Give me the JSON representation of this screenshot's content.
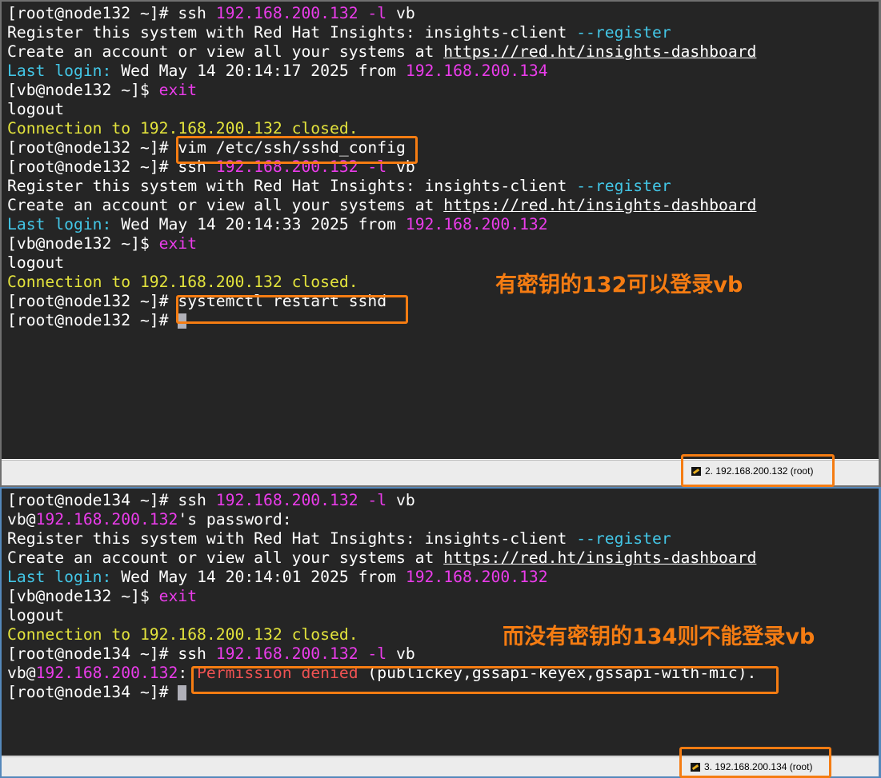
{
  "colors": {
    "terminal_bg": "#252525",
    "text": "#ffffff",
    "ip_magenta": "#ea3cea",
    "option_cyan": "#43c6e6",
    "connection_yellow": "#e3e33c",
    "error_red": "#ee5252",
    "annotation_orange": "#f57c12"
  },
  "panel1": {
    "lines": [
      [
        {
          "t": "[root@node132 ~]# ssh "
        },
        {
          "t": "192.168.200.132",
          "c": "magenta"
        },
        {
          "t": " "
        },
        {
          "t": "-l",
          "c": "magenta"
        },
        {
          "t": " vb"
        }
      ],
      [
        {
          "t": "Register this system with Red Hat Insights: insights-client "
        },
        {
          "t": "--register",
          "c": "cyan"
        }
      ],
      [
        {
          "t": "Create an account or view all your systems at "
        },
        {
          "t": "https://red.ht/insights-dashboard",
          "c": "link"
        }
      ],
      [
        {
          "t": "Last login:",
          "c": "cyan"
        },
        {
          "t": " Wed May 14 20:14:17 2025 from "
        },
        {
          "t": "192.168.200.134",
          "c": "magenta"
        }
      ],
      [
        {
          "t": "[vb@node132 ~]$ "
        },
        {
          "t": "exit",
          "c": "magenta"
        }
      ],
      [
        {
          "t": "logout"
        }
      ],
      [
        {
          "t": "Connection to 192.168.200.132 closed.",
          "c": "yellow"
        }
      ],
      [
        {
          "t": "[root@node132 ~]# vim /etc/ssh/sshd_config"
        }
      ],
      [
        {
          "t": "[root@node132 ~]# ssh "
        },
        {
          "t": "192.168.200.132",
          "c": "magenta"
        },
        {
          "t": " "
        },
        {
          "t": "-l",
          "c": "magenta"
        },
        {
          "t": " vb"
        }
      ],
      [
        {
          "t": "Register this system with Red Hat Insights: insights-client "
        },
        {
          "t": "--register",
          "c": "cyan"
        }
      ],
      [
        {
          "t": "Create an account or view all your systems at "
        },
        {
          "t": "https://red.ht/insights-dashboard",
          "c": "link"
        }
      ],
      [
        {
          "t": "Last login:",
          "c": "cyan"
        },
        {
          "t": " Wed May 14 20:14:33 2025 from "
        },
        {
          "t": "192.168.200.132",
          "c": "magenta"
        }
      ],
      [
        {
          "t": "[vb@node132 ~]$ "
        },
        {
          "t": "exit",
          "c": "magenta"
        }
      ],
      [
        {
          "t": "logout"
        }
      ],
      [
        {
          "t": "Connection to 192.168.200.132 closed.",
          "c": "yellow"
        }
      ],
      [
        {
          "t": "[root@node132 ~]# systemctl restart sshd"
        }
      ],
      [
        {
          "t": "[root@node132 ~]# "
        },
        {
          "cursor": true
        }
      ]
    ],
    "annotation": "有密钥的132可以登录vb",
    "session_tab": "2. 192.168.200.132 (root)",
    "session_icon": "pencil-icon"
  },
  "panel2": {
    "lines": [
      [
        {
          "t": "[root@node134 ~]# ssh "
        },
        {
          "t": "192.168.200.132",
          "c": "magenta"
        },
        {
          "t": " "
        },
        {
          "t": "-l",
          "c": "magenta"
        },
        {
          "t": " vb"
        }
      ],
      [
        {
          "t": "vb@"
        },
        {
          "t": "192.168.200.132",
          "c": "magenta"
        },
        {
          "t": "'s password:"
        }
      ],
      [
        {
          "t": "Register this system with Red Hat Insights: insights-client "
        },
        {
          "t": "--register",
          "c": "cyan"
        }
      ],
      [
        {
          "t": "Create an account or view all your systems at "
        },
        {
          "t": "https://red.ht/insights-dashboard",
          "c": "link"
        }
      ],
      [
        {
          "t": "Last login:",
          "c": "cyan"
        },
        {
          "t": " Wed May 14 20:14:01 2025 from "
        },
        {
          "t": "192.168.200.132",
          "c": "magenta"
        }
      ],
      [
        {
          "t": "[vb@node132 ~]$ "
        },
        {
          "t": "exit",
          "c": "magenta"
        }
      ],
      [
        {
          "t": "logout"
        }
      ],
      [
        {
          "t": "Connection to 192.168.200.132 closed.",
          "c": "yellow"
        }
      ],
      [
        {
          "t": "[root@node134 ~]# ssh "
        },
        {
          "t": "192.168.200.132",
          "c": "magenta"
        },
        {
          "t": " "
        },
        {
          "t": "-l",
          "c": "magenta"
        },
        {
          "t": " vb"
        }
      ],
      [
        {
          "t": "vb@"
        },
        {
          "t": "192.168.200.132",
          "c": "magenta"
        },
        {
          "t": ": "
        },
        {
          "t": "Permission denied",
          "c": "red"
        },
        {
          "t": " (publickey,gssapi-keyex,gssapi-with-mic)."
        }
      ],
      [
        {
          "t": "[root@node134 ~]# "
        },
        {
          "cursor": true
        }
      ]
    ],
    "annotation": "而没有密钥的134则不能登录vb",
    "session_tab": "3. 192.168.200.134 (root)",
    "session_icon": "pencil-icon"
  }
}
